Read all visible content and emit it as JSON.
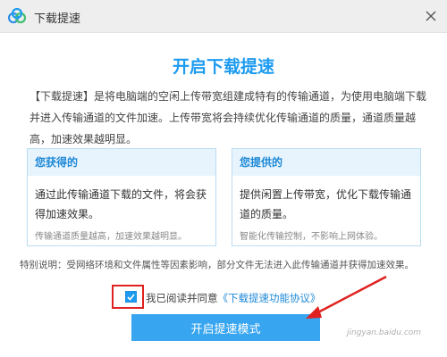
{
  "window": {
    "title": "下载提速",
    "close_icon": "close-icon",
    "logo_icon": "cloud-logo-icon"
  },
  "main": {
    "heading": "开启下载提速",
    "intro": "【下载提速】是将电脑端的空闲上传带宽组建成特有的传输通道，为使用电脑端下载并进入传输通道的文件加速。上传带宽将会持续优化传输通道的质量，通道质量越高，加速效果越明显。",
    "cards": [
      {
        "title": "您获得的",
        "body": "通过此传输通道下载的文件，将会获得加速效果。",
        "note": "传输通道质量越高，加速效果越明显。"
      },
      {
        "title": "您提供的",
        "body": "提供闲置上传带宽，优化下载传输通道的质量。",
        "note": "智能化传输控制，不影响上网体验。"
      }
    ],
    "notice": "特别说明：受网络环境和文件属性等因素影响，部分文件无法进入此传输通道并获得加速效果。"
  },
  "agreement": {
    "checked": true,
    "prefix": "我已阅读并同意",
    "link": "《下载提速功能协议》"
  },
  "actions": {
    "start_label": "开启提速模式"
  },
  "watermark": "jingyan.baidu.com",
  "colors": {
    "accent": "#1d9bf0",
    "button": "#37a5f0",
    "annotation": "#e0211f"
  }
}
